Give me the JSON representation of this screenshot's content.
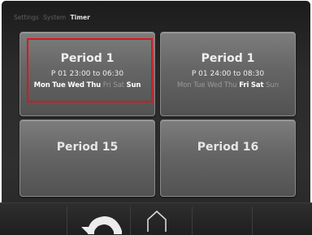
{
  "breadcrumb": {
    "items": [
      "Settings",
      "System"
    ],
    "current": "Timer"
  },
  "tiles": [
    {
      "title": "Period 1",
      "time": "P 01  23:00 to 06:30",
      "days": [
        {
          "label": "Mon",
          "active": true
        },
        {
          "label": "Tue",
          "active": true
        },
        {
          "label": "Wed",
          "active": true
        },
        {
          "label": "Thu",
          "active": true
        },
        {
          "label": "Fri",
          "active": false
        },
        {
          "label": "Sat",
          "active": false
        },
        {
          "label": "Sun",
          "active": true
        }
      ],
      "selected": true
    },
    {
      "title": "Period 1",
      "time": "P 01  24:00 to 08:30",
      "days": [
        {
          "label": "Mon",
          "active": false
        },
        {
          "label": "Tue",
          "active": false
        },
        {
          "label": "Wed",
          "active": false
        },
        {
          "label": "Thu",
          "active": false
        },
        {
          "label": "Fri",
          "active": true
        },
        {
          "label": "Sat",
          "active": true
        },
        {
          "label": "Sun",
          "active": false
        }
      ],
      "selected": false
    },
    {
      "title": "Period 15"
    },
    {
      "title": "Period 16"
    }
  ],
  "nav": {
    "back_icon": "back-arrow-icon",
    "home_icon": "home-icon"
  },
  "colors": {
    "highlight": "#e1141b",
    "tile": "#6a6a6a",
    "background": "#2b2b2b"
  }
}
